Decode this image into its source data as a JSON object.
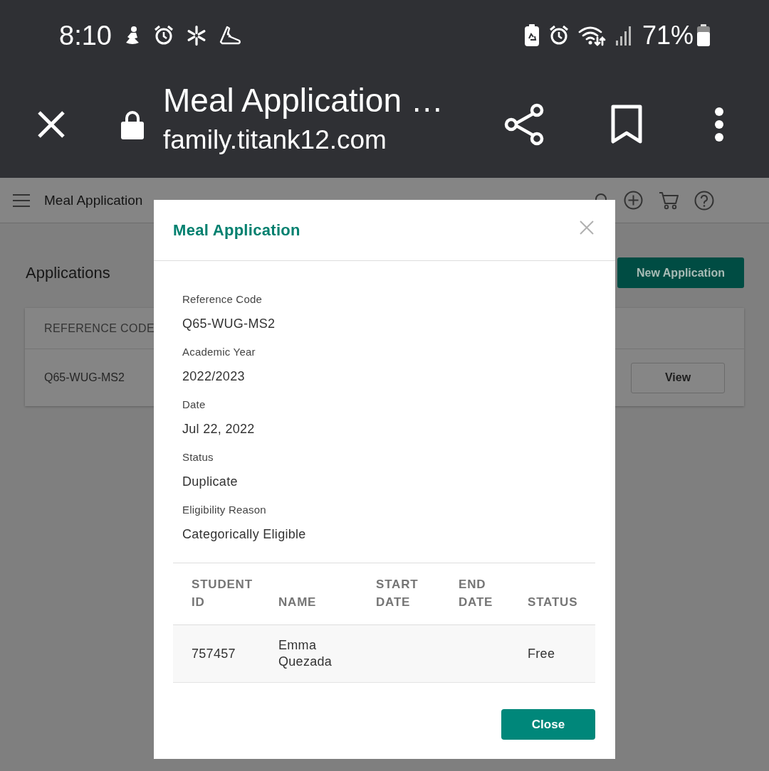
{
  "status_bar": {
    "time": "8:10",
    "battery": "71%"
  },
  "browser_bar": {
    "title": "Meal Application …",
    "url": "family.titank12.com"
  },
  "site_header": {
    "title": "Meal Application"
  },
  "page": {
    "heading": "Applications",
    "new_button": "New Application",
    "table": {
      "columns": [
        "REFERENCE CODE"
      ],
      "rows": [
        {
          "reference_code": "Q65-WUG-MS2",
          "action": "View"
        }
      ]
    }
  },
  "dialog": {
    "title": "Meal Application",
    "fields": [
      {
        "label": "Reference Code",
        "value": "Q65-WUG-MS2"
      },
      {
        "label": "Academic Year",
        "value": "2022/2023"
      },
      {
        "label": "Date",
        "value": "Jul 22, 2022"
      },
      {
        "label": "Status",
        "value": "Duplicate"
      },
      {
        "label": "Eligibility Reason",
        "value": "Categorically Eligible"
      }
    ],
    "table": {
      "columns": [
        "STUDENT ID",
        "NAME",
        "START DATE",
        "END DATE",
        "STATUS"
      ],
      "rows": [
        {
          "student_id": "757457",
          "name": "Emma Quezada",
          "status": "Free"
        }
      ]
    },
    "buttons": [
      "Close"
    ]
  }
}
